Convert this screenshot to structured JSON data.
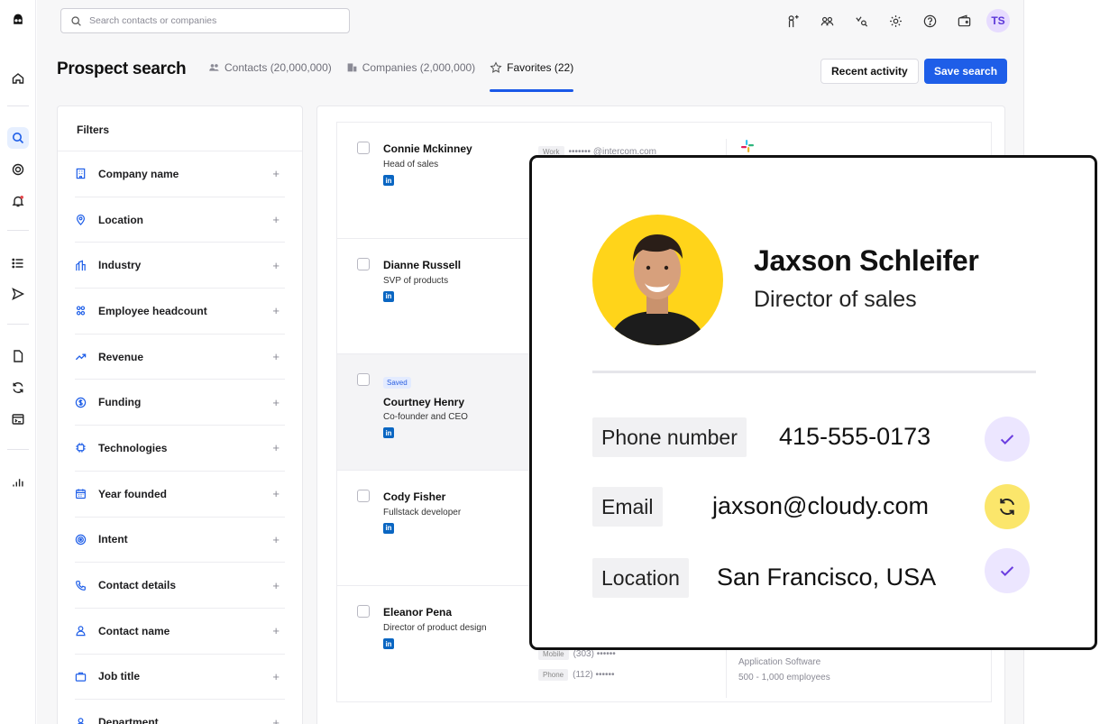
{
  "search": {
    "placeholder": "Search contacts or companies"
  },
  "user": {
    "initials": "TS"
  },
  "page": {
    "title": "Prospect search",
    "tabs": [
      {
        "label": "Contacts (20,000,000)"
      },
      {
        "label": "Companies  (2,000,000)"
      },
      {
        "label": "Favorites (22)"
      }
    ],
    "recent_activity": "Recent activity",
    "save_search": "Save search"
  },
  "filters": {
    "title": "Filters",
    "items": [
      {
        "label": "Company name",
        "icon": "building-icon"
      },
      {
        "label": "Location",
        "icon": "location-pin-icon"
      },
      {
        "label": "Industry",
        "icon": "industry-icon"
      },
      {
        "label": "Employee headcount",
        "icon": "people-icon"
      },
      {
        "label": "Revenue",
        "icon": "trend-up-icon"
      },
      {
        "label": "Funding",
        "icon": "dollar-icon"
      },
      {
        "label": "Technologies",
        "icon": "chip-icon"
      },
      {
        "label": "Year founded",
        "icon": "calendar-icon"
      },
      {
        "label": "Intent",
        "icon": "target-icon"
      },
      {
        "label": "Contact details",
        "icon": "phone-icon"
      },
      {
        "label": "Contact name",
        "icon": "person-icon"
      },
      {
        "label": "Job title",
        "icon": "briefcase-icon"
      },
      {
        "label": "Department",
        "icon": "person-icon"
      }
    ]
  },
  "results": {
    "rows": [
      {
        "name": "Connie Mckinney",
        "role": "Head of sales",
        "saved": false,
        "chip": "Work",
        "detail": "••••••• @intercom.com"
      },
      {
        "name": "Dianne Russell",
        "role": "SVP of products",
        "saved": false
      },
      {
        "name": "Courtney Henry",
        "role": "Co-founder and CEO",
        "saved": true,
        "saved_label": "Saved"
      },
      {
        "name": "Cody Fisher",
        "role": "Fullstack developer",
        "saved": false
      },
      {
        "name": "Eleanor Pena",
        "role": "Director of product design",
        "saved": false,
        "mobile_chip": "Mobile",
        "mobile": "(303) ••••••",
        "phone_chip": "Phone",
        "phone": "(112) ••••••",
        "industry": "Application Software",
        "employees": "500 - 1,000 employees"
      }
    ]
  },
  "card": {
    "name": "Jaxson Schleifer",
    "role": "Director of sales",
    "fields": [
      {
        "label": "Phone number",
        "value": "415-555-0173",
        "status": "verified"
      },
      {
        "label": "Email",
        "value": "jaxson@cloudy.com",
        "status": "syncing"
      },
      {
        "label": "Location",
        "value": "San Francisco, USA",
        "status": "verified"
      }
    ],
    "photo_bg": "#ffd41a"
  },
  "colors": {
    "accent": "#1e5ee8",
    "linkedin": "#0a66c2",
    "verified_bg": "#ece6ff",
    "sync_bg": "#fbe66b"
  }
}
